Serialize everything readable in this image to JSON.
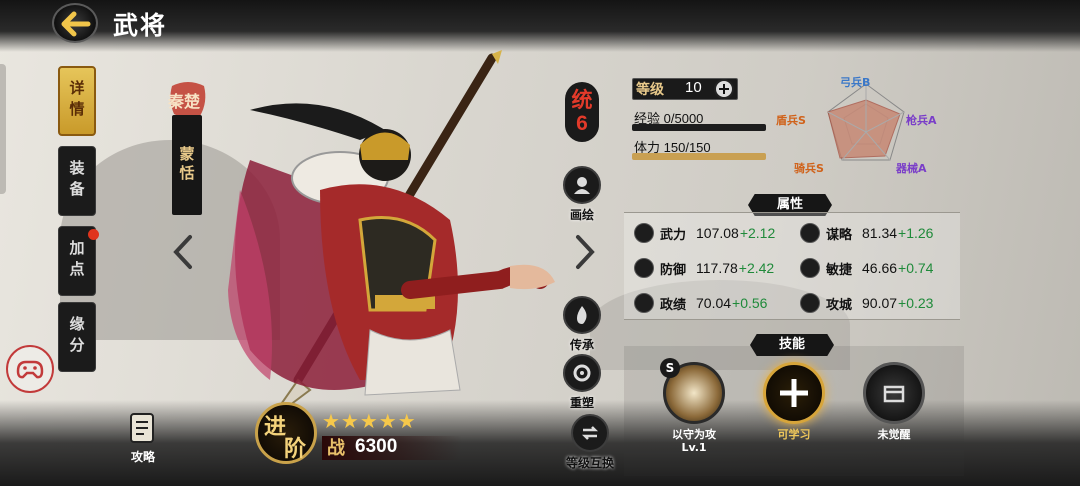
{
  "header": {
    "title": "武将"
  },
  "tabs": [
    {
      "label": "详情",
      "active": true
    },
    {
      "label": "装备",
      "active": false
    },
    {
      "label": "加点",
      "active": false,
      "badge": true
    },
    {
      "label": "缘分",
      "active": false
    }
  ],
  "hero": {
    "faction": "秦楚",
    "name": "蒙恬",
    "stars": "★★★★★",
    "power_label": "战",
    "power": "6300",
    "advance_label": [
      "进",
      "阶"
    ]
  },
  "guide": {
    "label": "攻略"
  },
  "command": {
    "label": "统",
    "value": "6"
  },
  "side_buttons": [
    {
      "label": "画绘",
      "icon": "portrait-icon"
    },
    {
      "label": "传承",
      "icon": "flame-icon"
    },
    {
      "label": "重塑",
      "icon": "reforge-icon"
    },
    {
      "label": "等级互换",
      "icon": "exchange-icon"
    }
  ],
  "level": {
    "label": "等级",
    "value": "10"
  },
  "exp": {
    "label": "经验",
    "value": "0/5000",
    "fraction": 0
  },
  "stamina": {
    "label": "体力",
    "value": "150/150",
    "fraction": 1
  },
  "troops": {
    "archer": "弓兵B",
    "spear": "枪兵A",
    "machine": "器械A",
    "cavalry": "骑兵S",
    "shield": "盾兵S"
  },
  "attributes": {
    "header": "属性",
    "items": [
      {
        "name": "武力",
        "value": "107.08",
        "bonus": "+2.12"
      },
      {
        "name": "谋略",
        "value": "81.34",
        "bonus": "+1.26"
      },
      {
        "name": "防御",
        "value": "117.78",
        "bonus": "+2.42"
      },
      {
        "name": "敏捷",
        "value": "46.66",
        "bonus": "+0.74"
      },
      {
        "name": "政绩",
        "value": "70.04",
        "bonus": "+0.56"
      },
      {
        "name": "攻城",
        "value": "90.07",
        "bonus": "+0.23"
      }
    ]
  },
  "skills": {
    "header": "技能",
    "items": [
      {
        "name": "以守为攻",
        "level": "Lv.1",
        "grade": "S"
      },
      {
        "name": "可学习"
      },
      {
        "name": "未觉醒"
      }
    ]
  },
  "colors": {
    "accent_gold": "#c9a052",
    "bonus_green": "#1f8a3a",
    "command_red": "#e23a2a"
  }
}
